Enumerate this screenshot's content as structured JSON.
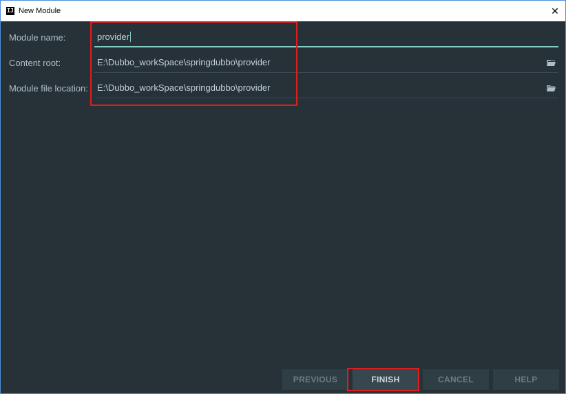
{
  "window": {
    "title": "New Module",
    "close_glyph": "✕"
  },
  "form": {
    "module_name_label": "Module name:",
    "module_name_value": "provider",
    "content_root_label": "Content root:",
    "content_root_value": "E:\\Dubbo_workSpace\\springdubbo\\provider",
    "module_file_location_label": "Module file location:",
    "module_file_location_value": "E:\\Dubbo_workSpace\\springdubbo\\provider"
  },
  "buttons": {
    "previous": "PREVIOUS",
    "finish": "FINISH",
    "cancel": "CANCEL",
    "help": "HELP"
  },
  "icons": {
    "app": "intellij-icon",
    "browse": "folder-icon"
  },
  "colors": {
    "background": "#263238",
    "focus_accent": "#80cbc4",
    "annotation": "#e01e1e"
  }
}
